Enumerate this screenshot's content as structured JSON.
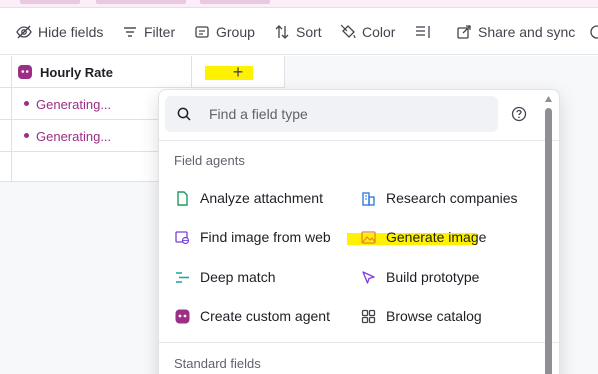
{
  "toolbar": {
    "hide_fields": "Hide fields",
    "filter": "Filter",
    "group": "Group",
    "sort": "Sort",
    "color": "Color",
    "share_sync": "Share and sync"
  },
  "grid": {
    "field_header": "Hourly Rate",
    "add_field_symbol": "+",
    "rows": [
      {
        "value": "Generating..."
      },
      {
        "value": "Generating..."
      }
    ]
  },
  "popup": {
    "search_placeholder": "Find a field type",
    "sections": {
      "agents": "Field agents",
      "standard": "Standard fields"
    },
    "agents": {
      "analyze_attachment": "Analyze attachment",
      "research_companies": "Research companies",
      "find_image_web": "Find image from web",
      "generate_image": "Generate image",
      "deep_match": "Deep match",
      "build_prototype": "Build prototype",
      "create_custom_agent": "Create custom agent",
      "browse_catalog": "Browse catalog"
    }
  },
  "colors": {
    "accent_purple": "#9c2e86",
    "highlight_yellow": "#fff200",
    "agent_green": "#1c9d5a",
    "agent_blue": "#2b74d6",
    "agent_teal": "#17a6a0",
    "agent_violet": "#7a3ee0",
    "agent_orange": "#e5852a"
  }
}
